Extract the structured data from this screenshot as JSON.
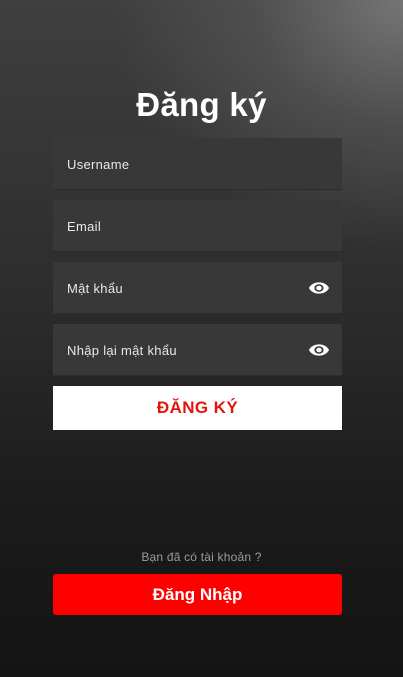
{
  "title": "Đăng ký",
  "fields": {
    "username": {
      "placeholder": "Username",
      "value": ""
    },
    "email": {
      "placeholder": "Email",
      "value": ""
    },
    "password": {
      "placeholder": "Mật khẩu",
      "value": "",
      "icon": "eye-icon"
    },
    "confirm_password": {
      "placeholder": "Nhập lại mật khẩu",
      "value": "",
      "icon": "eye-icon"
    }
  },
  "register_button": "ĐĂNG KÝ",
  "login_prompt": "Bạn đã có tài khoản ?",
  "login_button": "Đăng Nhập",
  "colors": {
    "accent_red": "#fe0000",
    "register_text": "#e5140f",
    "field_bg": "#383838"
  }
}
